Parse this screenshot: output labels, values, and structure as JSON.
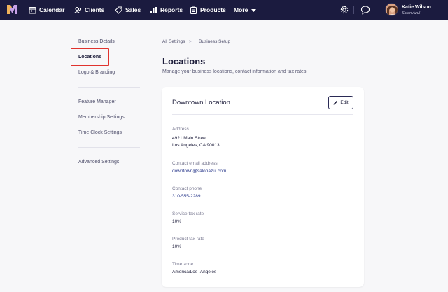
{
  "nav": {
    "items": [
      {
        "label": "Calendar",
        "icon": "calendar-icon"
      },
      {
        "label": "Clients",
        "icon": "clients-icon"
      },
      {
        "label": "Sales",
        "icon": "tag-icon"
      },
      {
        "label": "Reports",
        "icon": "bar-chart-icon"
      },
      {
        "label": "Products",
        "icon": "clipboard-icon"
      },
      {
        "label": "More",
        "icon": "caret-down-icon"
      }
    ],
    "user_name": "Katie Wilson",
    "user_business": "Salon Azul"
  },
  "sidebar": {
    "group1": [
      "Business Details",
      "Locations",
      "Logo & Branding"
    ],
    "group2": [
      "Feature Manager",
      "Membership Settings",
      "Time Clock Settings"
    ],
    "group3": [
      "Advanced Settings"
    ],
    "active": "Locations"
  },
  "breadcrumb": {
    "root": "All Settings",
    "separator": ">",
    "current": "Business Setup"
  },
  "page": {
    "title": "Locations",
    "subtitle": "Manage your business locations, contact information and tax rates."
  },
  "location": {
    "name": "Downtown Location",
    "edit_label": "Edit",
    "address_label": "Address",
    "address_line1": "4921 Main Street",
    "address_line2": "Los Angeles, CA 90013",
    "email_label": "Contact email address",
    "email": "downtown@salonazul.com",
    "phone_label": "Contact phone",
    "phone": "310-555-2289",
    "service_tax_label": "Service tax rate",
    "service_tax": "10%",
    "product_tax_label": "Product tax rate",
    "product_tax": "10%",
    "timezone_label": "Time zone",
    "timezone": "America/Los_Angeles"
  },
  "colors": {
    "nav_bg": "#1b1b3f",
    "page_bg": "#f7f7f9",
    "link_blue": "#2b3a8c",
    "highlight_red": "#e0332e"
  }
}
